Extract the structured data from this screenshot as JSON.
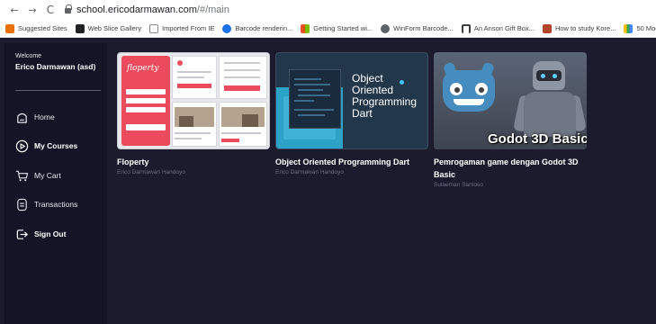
{
  "browser": {
    "nav": {
      "back": "←",
      "forward": "→",
      "reload": "C"
    },
    "url_host": "school.ericodarmawan.com",
    "url_path": "/#/main"
  },
  "bookmarks": [
    {
      "label": "Suggested Sites",
      "color": "#e8710a"
    },
    {
      "label": "Web Slice Gallery",
      "color": "#202124"
    },
    {
      "label": "Imported From IE",
      "color": "#b3b3b3"
    },
    {
      "label": "Barcode renderin...",
      "color": "#1a73e8"
    },
    {
      "label": "Getting Started wi...",
      "color": "#f4b400"
    },
    {
      "label": "WinForm Barcode...",
      "color": "#5f6368"
    },
    {
      "label": "An Anson Gift Box...",
      "color": "#3c4043"
    },
    {
      "label": "How to study Kore...",
      "color": "#b0442c"
    },
    {
      "label": "50 Modern S",
      "color": "#fbbc04"
    }
  ],
  "sidebar": {
    "welcome": "Welcome",
    "user_name": "Erico Darmawan (asd)",
    "items": [
      {
        "label": "Home",
        "icon": "home-icon",
        "active": false
      },
      {
        "label": "My Courses",
        "icon": "play-circle-icon",
        "active": true
      },
      {
        "label": "My Cart",
        "icon": "cart-icon",
        "active": false
      },
      {
        "label": "Transactions",
        "icon": "receipt-icon",
        "active": false
      },
      {
        "label": "Sign Out",
        "icon": "sign-out-icon",
        "active": true
      }
    ]
  },
  "courses": [
    {
      "title": "Floperty",
      "author": "Erico Darmawan Handoyo",
      "thumb_text": "floperty"
    },
    {
      "title": "Object Oriented Programming Dart",
      "author": "Erico Darmawan Handoyo",
      "thumb_text": "Object Oriented Programming Dart"
    },
    {
      "title": "Pemrogaman game dengan Godot 3D Basic",
      "author": "Sulaeman Santoso",
      "thumb_text": "Godot 3D Basic"
    }
  ],
  "colors": {
    "background": "#1c1b2d",
    "sidebar": "#131526",
    "floperty_red": "#ec4a5d",
    "godot_blue": "#478cbf"
  }
}
